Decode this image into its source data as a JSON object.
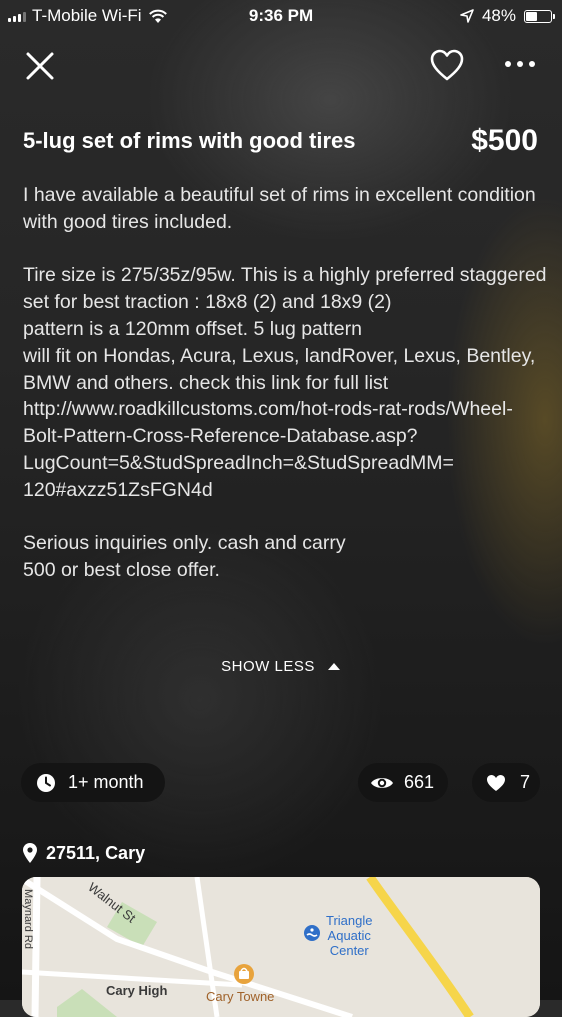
{
  "status_bar": {
    "carrier": "T-Mobile Wi-Fi",
    "time": "9:36 PM",
    "battery": "48%",
    "battery_level": 0.48
  },
  "nav": {
    "close_icon": "close-icon",
    "favorite_icon": "heart-outline-icon",
    "more_icon": "more-dots-icon"
  },
  "listing": {
    "title": "5-lug set of rims with good tires",
    "price": "$500",
    "description": "I have available a beautiful set of rims in excellent condition with good tires included.\n\nTire size is 275/35z/95w. This is a highly preferred staggered set for best traction : 18x8 (2) and 18x9 (2)\npattern is a 120mm offset. 5 lug pattern\nwill fit on Hondas, Acura, Lexus, landRover, Lexus, Bentley, BMW and others. check this link for full list http://www.roadkillcustoms.com/hot-rods-rat-rods/Wheel-Bolt-Pattern-Cross-Reference-Database.asp?\nLugCount=5&StudSpreadInch=&StudSpreadMM=\n120#axzz51ZsFGN4d\n\nSerious inquiries only. cash and carry\n500 or best close offer.",
    "show_less": "SHOW LESS"
  },
  "stats": {
    "age": "1+ month",
    "views": "661",
    "likes": "7"
  },
  "location": {
    "text": "27511, Cary"
  },
  "map": {
    "street_1": "Walnut St",
    "street_2": "Maynard Rd",
    "poi_1": "Triangle\nAquatic\nCenter",
    "poi_2": "Cary High",
    "poi_3": "Cary Towne"
  },
  "colors": {
    "pill_bg": "#141414",
    "map_road": "#f6d54a",
    "poi_blue": "#2f6fc8"
  }
}
